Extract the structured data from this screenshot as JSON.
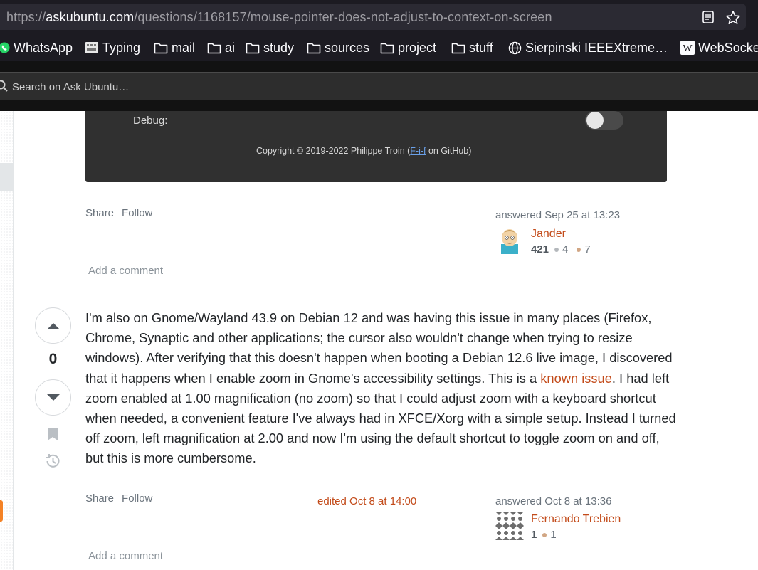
{
  "browser": {
    "url_scheme": "https://",
    "url_host": "askubuntu.com",
    "url_path": "/questions/1168157/mouse-pointer-does-not-adjust-to-context-on-screen",
    "bookmarks": [
      {
        "label": "WhatsApp",
        "icon": "whatsapp-icon"
      },
      {
        "label": "Typing",
        "icon": "typing-icon"
      },
      {
        "label": "mail",
        "icon": "folder-icon"
      },
      {
        "label": "ai",
        "icon": "folder-icon"
      },
      {
        "label": "study",
        "icon": "folder-icon"
      },
      {
        "label": "sources",
        "icon": "folder-icon"
      },
      {
        "label": "project",
        "icon": "folder-icon"
      },
      {
        "label": "stuff",
        "icon": "folder-icon"
      },
      {
        "label": "Sierpinski IEEEXtreme…",
        "icon": "globe-icon"
      },
      {
        "label": "WebSocke",
        "icon": "wikipedia-icon"
      }
    ]
  },
  "site_search": {
    "placeholder": "Search on Ask Ubuntu…"
  },
  "answer1": {
    "screenshot": {
      "debug_label": "Debug:",
      "copyright_prefix": "Copyright © 2019-2022 Philippe Troin (",
      "copyright_link": "F-i-f",
      "copyright_suffix": " on GitHub)"
    },
    "share": "Share",
    "follow": "Follow",
    "answered": "answered Sep 25 at 13:23",
    "user": {
      "name": "Jander",
      "rep": "421",
      "silver": "4",
      "bronze": "7"
    },
    "add_comment": "Add a comment"
  },
  "answer2": {
    "score": "0",
    "body_before": "I'm also on Gnome/Wayland 43.9 on Debian 12 and was having this issue in many places (Firefox, Chrome, Synaptic and other applications; the cursor also wouldn't change when trying to resize windows). After verifying that this doesn't happen when booting a Debian 12.6 live image, I discovered that it happens when I enable zoom in Gnome's accessibility settings. This is a ",
    "body_link": "known issue",
    "body_after": ". I had left zoom enabled at 1.00 magnification (no zoom) so that I could adjust zoom with a keyboard shortcut when needed, a convenient feature I've always had in XFCE/Xorg with a simple setup. Instead I turned off zoom, left magnification at 2.00 and now I'm using the default shortcut to toggle zoom on and off, but this is more cumbersome.",
    "share": "Share",
    "follow": "Follow",
    "edited": "edited Oct 8 at 14:00",
    "answered": "answered Oct 8 at 13:36",
    "user": {
      "name": "Fernando Trebien",
      "rep": "1",
      "bronze": "1"
    },
    "add_comment": "Add a comment"
  },
  "colors": {
    "link": "#c34b1a",
    "accent_orange": "#f48225",
    "browser_bg": "#1c1b22"
  }
}
